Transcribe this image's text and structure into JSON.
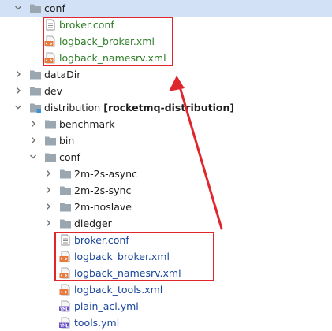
{
  "tree": [
    {
      "id": "conf-top",
      "label": "conf",
      "type": "folder",
      "expanded": true,
      "selected": true,
      "depth": 0
    },
    {
      "id": "broker-conf-top",
      "label": "broker.conf",
      "type": "file-text",
      "depth": 1,
      "color": "green"
    },
    {
      "id": "logback-broker-top",
      "label": "logback_broker.xml",
      "type": "file-xml",
      "depth": 1,
      "color": "green"
    },
    {
      "id": "logback-namesrv-top",
      "label": "logback_namesrv.xml",
      "type": "file-xml",
      "depth": 1,
      "color": "green"
    },
    {
      "id": "datadir",
      "label": "dataDir",
      "type": "folder",
      "expanded": false,
      "depth": 0
    },
    {
      "id": "dev",
      "label": "dev",
      "type": "folder",
      "expanded": false,
      "depth": 0
    },
    {
      "id": "distribution",
      "label": "distribution",
      "module": "[rocketmq-distribution]",
      "type": "module-folder",
      "expanded": true,
      "depth": 0
    },
    {
      "id": "benchmark",
      "label": "benchmark",
      "type": "folder",
      "expanded": false,
      "depth": 1
    },
    {
      "id": "bin",
      "label": "bin",
      "type": "folder",
      "expanded": false,
      "depth": 1
    },
    {
      "id": "conf-dist",
      "label": "conf",
      "type": "folder",
      "expanded": true,
      "depth": 1
    },
    {
      "id": "2m-2s-async",
      "label": "2m-2s-async",
      "type": "folder",
      "expanded": false,
      "depth": 2
    },
    {
      "id": "2m-2s-sync",
      "label": "2m-2s-sync",
      "type": "folder",
      "expanded": false,
      "depth": 2
    },
    {
      "id": "2m-noslave",
      "label": "2m-noslave",
      "type": "folder",
      "expanded": false,
      "depth": 2
    },
    {
      "id": "dledger",
      "label": "dledger",
      "type": "folder",
      "expanded": false,
      "depth": 2
    },
    {
      "id": "broker-conf-dist",
      "label": "broker.conf",
      "type": "file-text",
      "depth": 2,
      "color": "blue"
    },
    {
      "id": "logback-broker-dist",
      "label": "logback_broker.xml",
      "type": "file-xml",
      "depth": 2,
      "color": "blue"
    },
    {
      "id": "logback-namesrv-dist",
      "label": "logback_namesrv.xml",
      "type": "file-xml",
      "depth": 2,
      "color": "blue"
    },
    {
      "id": "logback-tools",
      "label": "logback_tools.xml",
      "type": "file-xml",
      "depth": 2,
      "color": "blue"
    },
    {
      "id": "plain-acl",
      "label": "plain_acl.yml",
      "type": "file-yml",
      "depth": 2,
      "color": "blue"
    },
    {
      "id": "tools-yml",
      "label": "tools.yml",
      "type": "file-yml",
      "depth": 2,
      "color": "blue"
    }
  ],
  "colors": {
    "selection": "#d3e1f7",
    "folder": "#9aa7b0",
    "xml_icon": "#e8793c",
    "yml_icon": "#6c52c9",
    "highlight_box": "#e0262d",
    "vcs_added": "#2d7d26",
    "vcs_modified": "#19469a"
  },
  "icons": {
    "folder": "folder-icon",
    "module": "module-folder-icon",
    "text": "text-file-icon",
    "xml": "xml-file-icon",
    "yml": "yml-file-icon",
    "collapsed": "chevron-right-icon",
    "expanded": "chevron-down-icon"
  }
}
